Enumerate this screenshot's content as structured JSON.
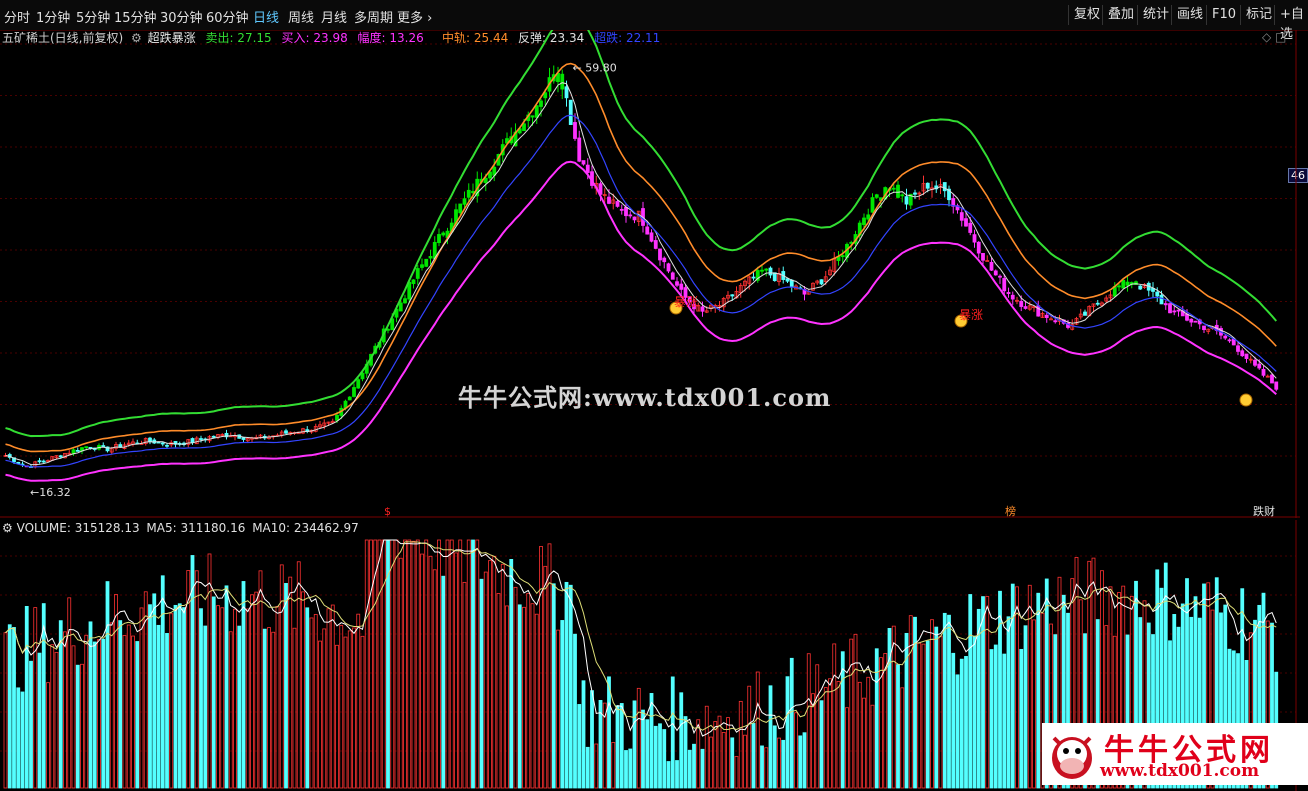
{
  "toolbar": {
    "periods": [
      "分时",
      "1分钟",
      "5分钟",
      "15分钟",
      "30分钟",
      "60分钟",
      "日线",
      "周线",
      "月线",
      "多周期",
      "更多"
    ],
    "active_period": "日线",
    "right_buttons": [
      "复权",
      "叠加",
      "统计",
      "画线",
      "F10",
      "标记",
      "+自选"
    ]
  },
  "main_legend": {
    "stock_name": "五矿稀土(日线,前复权)",
    "indicator": "超跌暴涨",
    "sell_label": "卖出: 27.15",
    "buy_label": "买入: 23.98",
    "range_label": "幅度: 13.26",
    "mid_label": "中轨: 25.44",
    "rebound_label": "反弹: 23.34",
    "oversold_label": "超跌: 22.11"
  },
  "annotations": {
    "high": "59.80",
    "low": "16.32",
    "surge": "暴涨",
    "right_tag": "46",
    "bottom_tags": [
      "$",
      "榜",
      "跌财"
    ]
  },
  "volume_legend": {
    "volume_label": "VOLUME: 315128.13",
    "ma5_label": "MA5: 311180.16",
    "ma10_label": "MA10: 234462.97"
  },
  "watermark": "牛牛公式网:www.tdx001.com",
  "logo": {
    "title": "牛牛公式网",
    "url": "www.tdx001.com"
  },
  "colors": {
    "up": "#ff3232",
    "up_fill": "#00e600",
    "down": "#54ffff",
    "magenta": "#ff33ff",
    "upper_band": "#33dd33",
    "orange": "#ff8c2a",
    "white_line": "#e0e0e0",
    "blue_line": "#3344ff"
  },
  "chart_data": {
    "type": "candlestick",
    "title": "五矿稀土(日线,前复权)",
    "price_high": 59.8,
    "price_low": 16.32,
    "close_path": [
      17.5,
      16.3,
      17.0,
      17.8,
      18.5,
      18.2,
      18.8,
      19.1,
      18.7,
      19.0,
      19.5,
      19.8,
      19.3,
      19.6,
      20.1,
      20.4,
      21.0,
      25.0,
      29.0,
      33.0,
      37.0,
      40.5,
      44.0,
      47.0,
      50.0,
      53.0,
      56.0,
      59.8,
      50.0,
      46.0,
      44.0,
      43.5,
      39.0,
      35.0,
      33.0,
      34.0,
      36.0,
      37.5,
      36.5,
      35.0,
      37.0,
      40.0,
      44.0,
      47.0,
      45.0,
      47.0,
      46.0,
      42.0,
      38.0,
      35.0,
      33.5,
      32.5,
      31.5,
      33.5,
      35.5,
      36.5,
      35.0,
      33.0,
      32.0,
      31.0,
      29.5,
      27.0,
      25.0
    ],
    "volume_bars_approx": 300,
    "volume": {
      "last": 315128.13,
      "ma5": 311180.16,
      "ma10": 234462.97
    }
  }
}
